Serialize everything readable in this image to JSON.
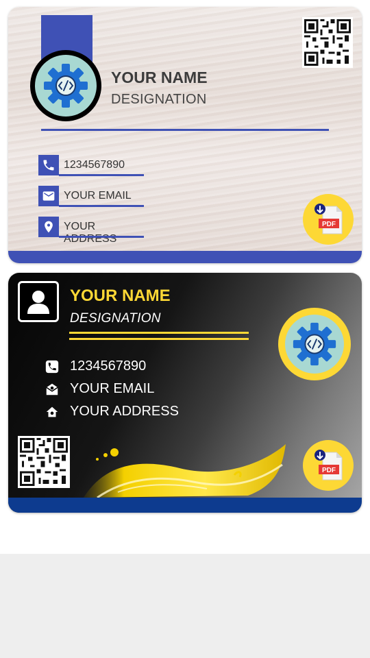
{
  "card1": {
    "name": "YOUR NAME",
    "designation": "DESIGNATION",
    "phone": "1234567890",
    "email": "YOUR EMAIL",
    "address": "YOUR ADDRESS",
    "pdf_label": "PDF",
    "accent_color": "#3f51b5",
    "icons": [
      "gear-code-icon",
      "qr-code-icon",
      "phone-icon",
      "email-icon",
      "location-pin-icon",
      "pdf-download-icon"
    ]
  },
  "card2": {
    "name": "YOUR NAME",
    "designation": "DESIGNATION",
    "phone": "1234567890",
    "email": "YOUR EMAIL",
    "address": "YOUR ADDRESS",
    "pdf_label": "PDF",
    "accent_color": "#fdd835",
    "bottom_color": "#0d3b8f",
    "icons": [
      "avatar-icon",
      "gear-code-icon",
      "phone-icon",
      "email-icon",
      "home-location-icon",
      "qr-code-icon",
      "pdf-download-icon"
    ]
  }
}
